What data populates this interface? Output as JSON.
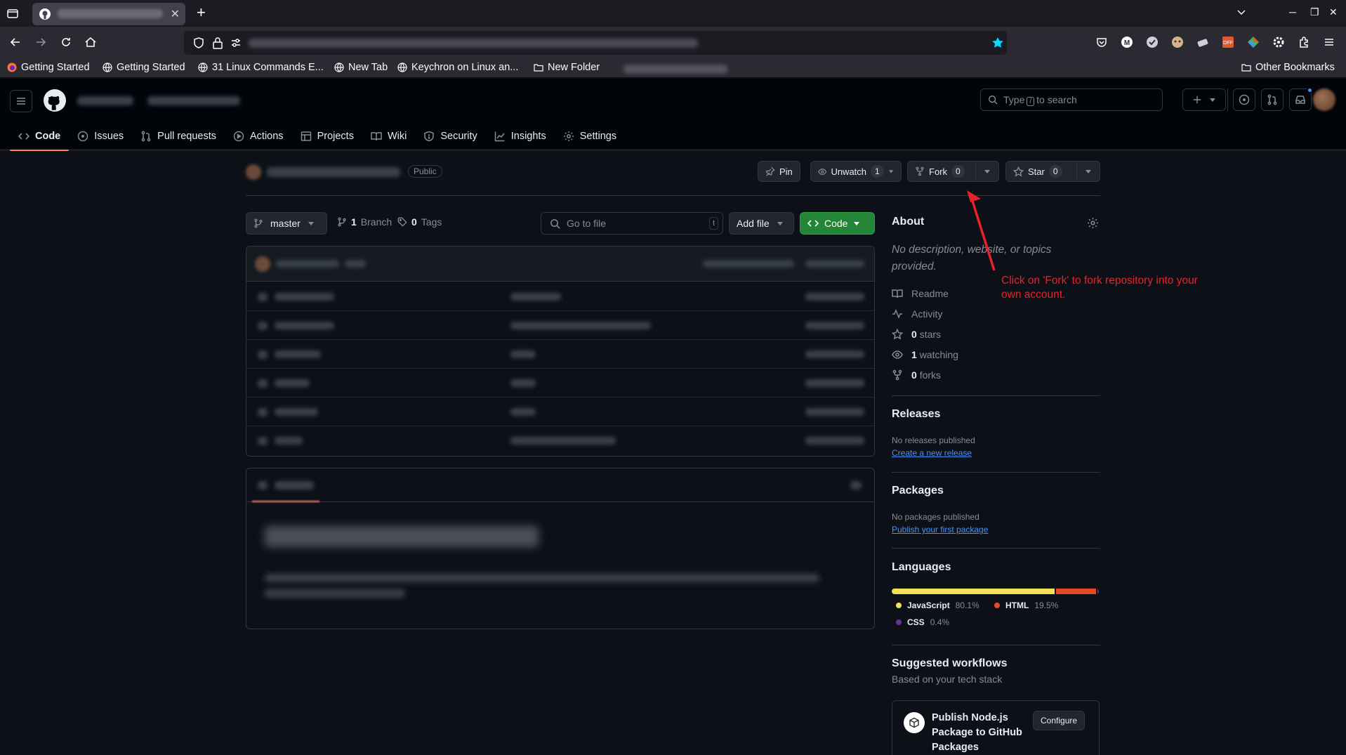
{
  "browser": {
    "bookmarks": [
      "Getting Started",
      "Getting Started",
      "31 Linux Commands E...",
      "New Tab",
      "Keychron on Linux an...",
      "New Folder"
    ],
    "other_bookmarks": "Other Bookmarks"
  },
  "header": {
    "search_prefix": "Type",
    "search_key": "/",
    "search_suffix": "to search"
  },
  "repo_tabs": [
    "Code",
    "Issues",
    "Pull requests",
    "Actions",
    "Projects",
    "Wiki",
    "Security",
    "Insights",
    "Settings"
  ],
  "repo": {
    "visibility": "Public",
    "pin_label": "Pin",
    "unwatch_label": "Unwatch",
    "unwatch_count": "1",
    "fork_label": "Fork",
    "fork_count": "0",
    "star_label": "Star",
    "star_count": "0"
  },
  "toolbar": {
    "branch": "master",
    "branch_count": "1",
    "branch_label": "Branch",
    "tag_count": "0",
    "tag_label": "Tags",
    "go_to_file": "Go to file",
    "go_to_file_key": "t",
    "add_file": "Add file",
    "code": "Code"
  },
  "about": {
    "title": "About",
    "description": "No description, website, or topics provided.",
    "readme": "Readme",
    "activity": "Activity",
    "stars_count": "0",
    "stars_label": "stars",
    "watching_count": "1",
    "watching_label": "watching",
    "forks_count": "0",
    "forks_label": "forks"
  },
  "releases": {
    "title": "Releases",
    "none": "No releases published",
    "create": "Create a new release"
  },
  "packages": {
    "title": "Packages",
    "none": "No packages published",
    "publish": "Publish your first package"
  },
  "languages": {
    "title": "Languages",
    "items": [
      {
        "name": "JavaScript",
        "pct": "80.1%",
        "value": 80.1,
        "color": "#f1e05a"
      },
      {
        "name": "HTML",
        "pct": "19.5%",
        "value": 19.5,
        "color": "#e34c26"
      },
      {
        "name": "CSS",
        "pct": "0.4%",
        "value": 0.4,
        "color": "#663399"
      }
    ]
  },
  "workflows": {
    "title": "Suggested workflows",
    "subtitle": "Based on your tech stack",
    "card_title": "Publish Node.js Package to GitHub Packages",
    "configure": "Configure"
  },
  "annotation": {
    "text": "Click on 'Fork' to fork repository into your own account.",
    "color": "#e8222a"
  }
}
